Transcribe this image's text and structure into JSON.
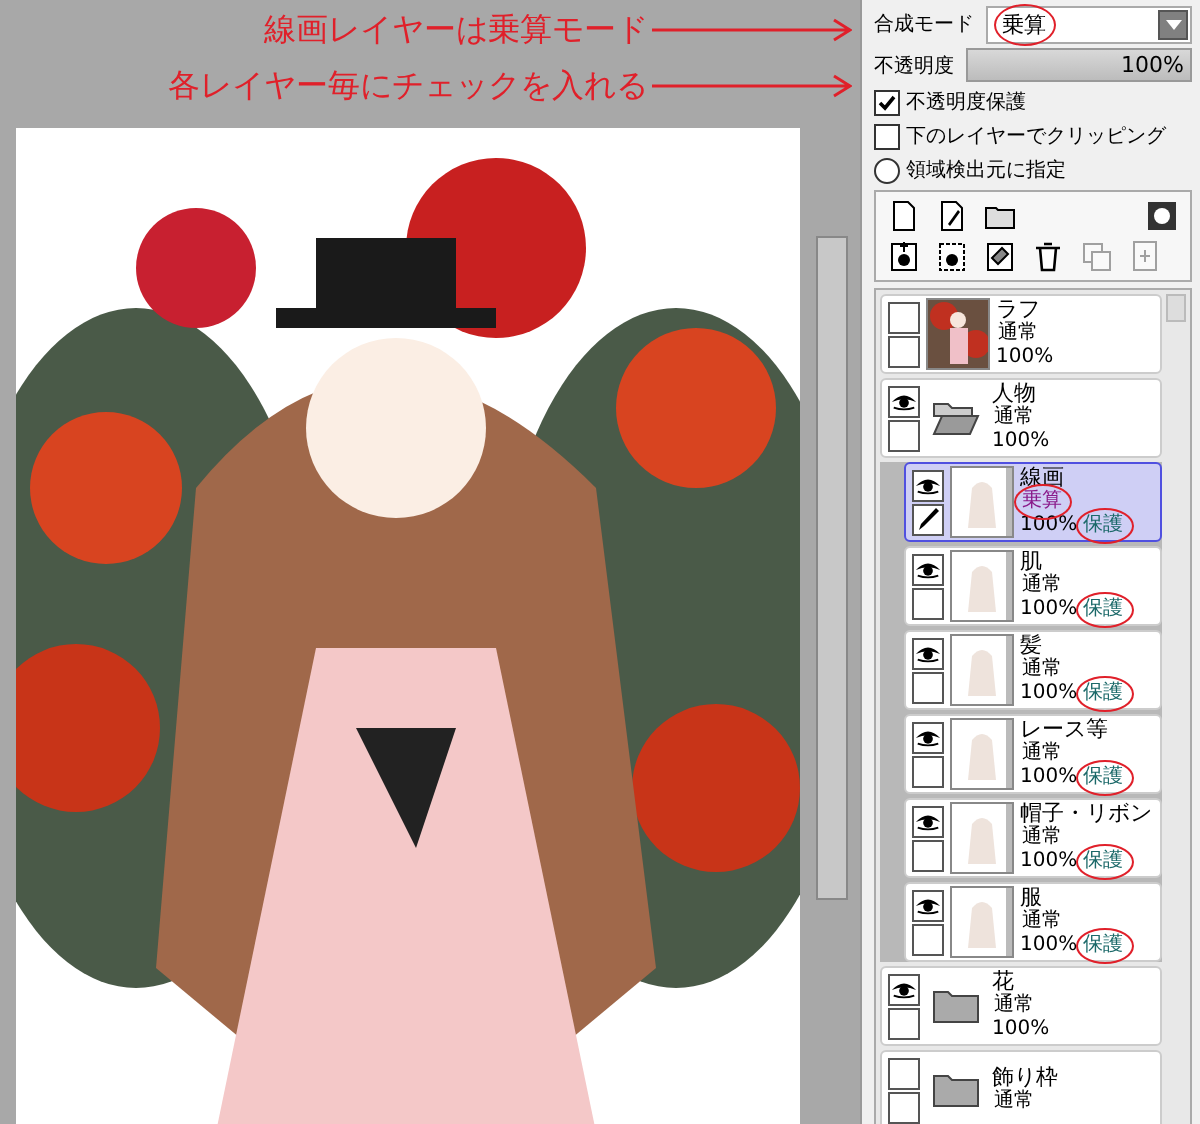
{
  "annotations": [
    {
      "text": "線画レイヤーは乗算モード"
    },
    {
      "text": "各レイヤー毎にチェックを入れる"
    }
  ],
  "blend": {
    "label": "合成モード",
    "value": "乗算",
    "circled": true
  },
  "opacity": {
    "label": "不透明度",
    "value": "100%",
    "level": 1
  },
  "options": [
    {
      "kind": "checkbox",
      "label": "不透明度保護",
      "checked": true
    },
    {
      "kind": "checkbox",
      "label": "下のレイヤーでクリッピング",
      "checked": false
    },
    {
      "kind": "radio",
      "label": "領域検出元に指定",
      "checked": false
    }
  ],
  "layers": [
    {
      "kind": "layer",
      "name": "ラフ",
      "mode": "通常",
      "color": "#000000",
      "mode_circled": false,
      "opacity": "100%",
      "visible": false,
      "selected": false
    },
    {
      "kind": "folder",
      "name": "人物",
      "mode": "通常",
      "color": "#000000",
      "mode_circled": false,
      "opacity": "100%",
      "visible": true,
      "selected": false,
      "expanded": true,
      "children": [
        {
          "kind": "layer",
          "name": "線画",
          "mode": "乗算",
          "color": "#8a1a8a",
          "mode_circled": true,
          "opacity": "100%",
          "protect": "保護",
          "protect_circled": true,
          "visible": true,
          "selected": true
        },
        {
          "kind": "layer",
          "name": "肌",
          "mode": "通常",
          "color": "#000000",
          "mode_circled": false,
          "opacity": "100%",
          "protect": "保護",
          "protect_circled": true,
          "visible": true,
          "selected": false
        },
        {
          "kind": "layer",
          "name": "髪",
          "mode": "通常",
          "color": "#000000",
          "mode_circled": false,
          "opacity": "100%",
          "protect": "保護",
          "protect_circled": true,
          "visible": true,
          "selected": false
        },
        {
          "kind": "layer",
          "name": "レース等",
          "mode": "通常",
          "color": "#000000",
          "mode_circled": false,
          "opacity": "100%",
          "protect": "保護",
          "protect_circled": true,
          "visible": true,
          "selected": false
        },
        {
          "kind": "layer",
          "name": "帽子・リボン",
          "mode": "通常",
          "color": "#000000",
          "mode_circled": false,
          "opacity": "100%",
          "protect": "保護",
          "protect_circled": true,
          "visible": true,
          "selected": false
        },
        {
          "kind": "layer",
          "name": "服",
          "mode": "通常",
          "color": "#000000",
          "mode_circled": false,
          "opacity": "100%",
          "protect": "保護",
          "protect_circled": true,
          "visible": true,
          "selected": false
        }
      ]
    },
    {
      "kind": "folder",
      "name": "花",
      "mode": "通常",
      "color": "#000000",
      "mode_circled": false,
      "opacity": "100%",
      "visible": true,
      "selected": false,
      "expanded": false
    },
    {
      "kind": "folder",
      "name": "飾り枠",
      "mode": "通常",
      "color": "#000000",
      "mode_circled": false,
      "visible": false,
      "selected": false,
      "expanded": false
    }
  ]
}
